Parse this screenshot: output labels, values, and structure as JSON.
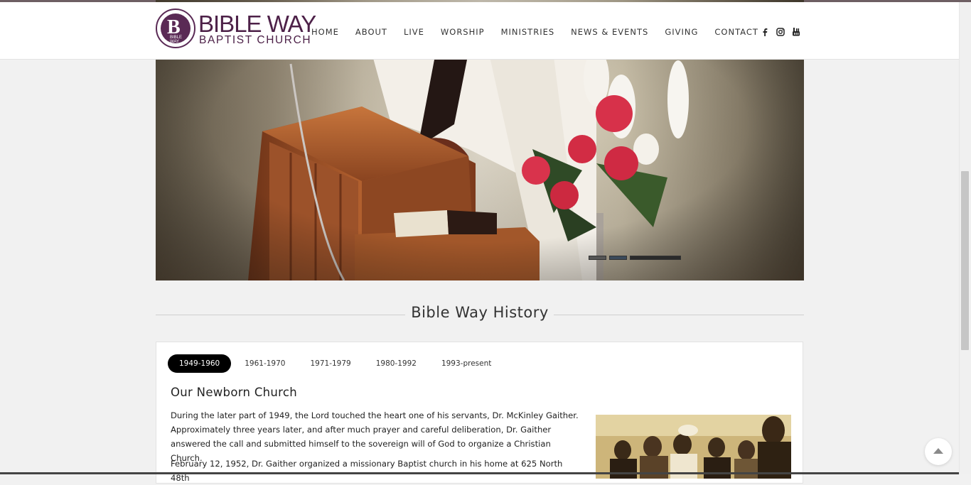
{
  "brand": {
    "name_line1": "BIBLE WAY",
    "name_line2": "BAPTIST CHURCH",
    "mark_letter": "B",
    "mark_subtext": "BIBLE WAY",
    "color": "#4d2148"
  },
  "nav": {
    "items": [
      {
        "label": "HOME"
      },
      {
        "label": "ABOUT"
      },
      {
        "label": "LIVE"
      },
      {
        "label": "WORSHIP"
      },
      {
        "label": "MINISTRIES"
      },
      {
        "label": "NEWS & EVENTS"
      },
      {
        "label": "GIVING"
      },
      {
        "label": "CONTACT"
      }
    ]
  },
  "social": [
    "facebook-icon",
    "instagram-icon",
    "youtube-icon"
  ],
  "hero": {
    "slides_count": 3,
    "active_slide": 2
  },
  "history": {
    "title": "Bible Way History",
    "tabs": [
      {
        "label": "1949-1960",
        "active": true
      },
      {
        "label": "1961-1970",
        "active": false
      },
      {
        "label": "1971-1979",
        "active": false
      },
      {
        "label": "1980-1992",
        "active": false
      },
      {
        "label": "1993-present",
        "active": false
      }
    ],
    "heading": "Our Newborn Church",
    "paragraph1": "During the later part of 1949, the Lord touched the heart one of his servants, Dr. McKinley Gaither. Approximately three years later, and after much prayer and careful deliberation, Dr. Gaither answered the call and submitted himself to the sovereign will of God to organize a Christian Church.",
    "paragraph2": "February 12, 1952, Dr. Gaither organized a missionary Baptist church in his home at 625 North 48th"
  },
  "colors": {
    "accent": "#000000",
    "brand": "#4d2148",
    "page_bg": "#f1f1f1"
  }
}
